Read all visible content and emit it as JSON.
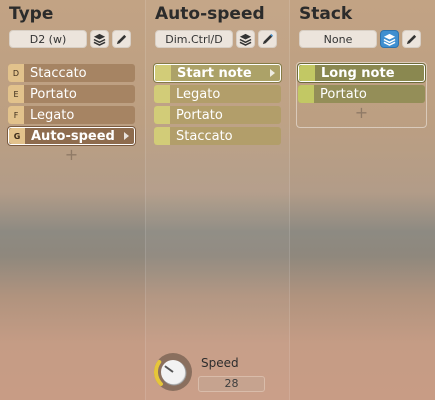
{
  "type_col": {
    "title": "Type",
    "select_value": "D2 (w)",
    "items": [
      {
        "key": "D",
        "label": "Staccato"
      },
      {
        "key": "E",
        "label": "Portato"
      },
      {
        "key": "F",
        "label": "Legato"
      },
      {
        "key": "G",
        "label": "Auto-speed",
        "selected": true
      }
    ],
    "add_label": "+"
  },
  "auto_col": {
    "title": "Auto-speed",
    "select_value": "Dim.Ctrl/D",
    "items": [
      {
        "label": "Start note",
        "selected": true
      },
      {
        "label": "Legato"
      },
      {
        "label": "Portato"
      },
      {
        "label": "Staccato"
      }
    ]
  },
  "stack_col": {
    "title": "Stack",
    "select_value": "None",
    "items": [
      {
        "label": "Long note",
        "selected": true
      },
      {
        "label": "Portato"
      }
    ],
    "add_label": "+"
  },
  "speed": {
    "label": "Speed",
    "value": "28",
    "level": 0.3
  },
  "colors": {
    "accent_blue": "#3f8fd0",
    "selected_border": "#ffffff"
  }
}
